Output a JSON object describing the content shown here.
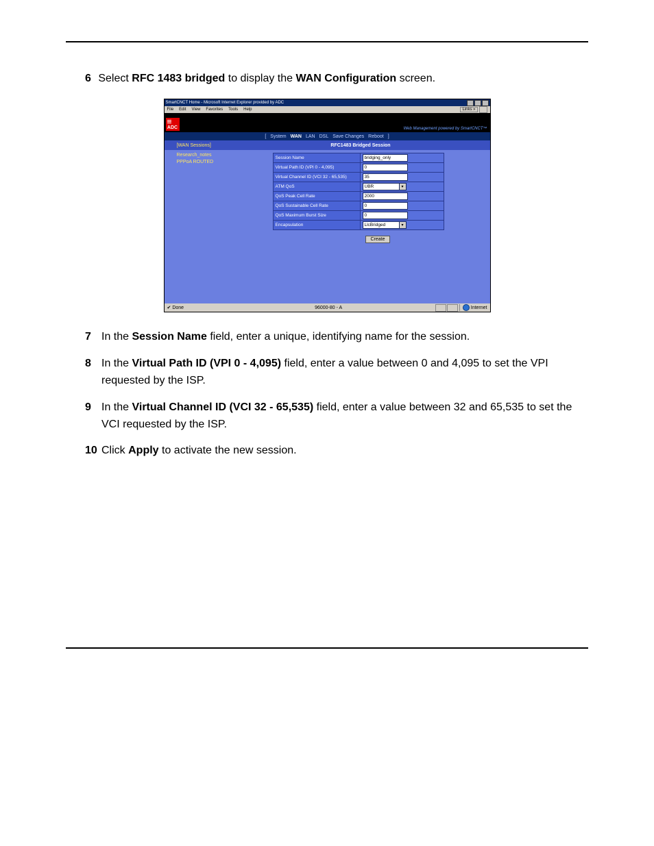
{
  "instruction": {
    "number": "6",
    "prefix": "Select ",
    "link": "RFC 1483 bridged",
    "middle": " to display the ",
    "screen_name": "WAN Configuration",
    "suffix": " screen."
  },
  "screenshot": {
    "window_title": "SmartCNCT Home - Microsoft Internet Explorer provided by ADC",
    "menus": [
      "File",
      "Edit",
      "View",
      "Favorites",
      "Tools",
      "Help"
    ],
    "links_label": "Links »",
    "logo": "ADC",
    "tagline": "Web Management powered by SmartCNCT™",
    "nav": {
      "left_bracket": "[",
      "items": [
        "System",
        "WAN",
        "LAN",
        "DSL",
        "Save Changes",
        "Reboot"
      ],
      "active": "WAN",
      "right_bracket": "]"
    },
    "bar2": {
      "sessions": "[WAN Sessions]",
      "title": "RFC1483 Bridged Session"
    },
    "sidebar": [
      "Research_notes",
      "PPPoA ROUTED"
    ],
    "rows": [
      {
        "label": "Session Name",
        "value": "bridging_only",
        "type": "input"
      },
      {
        "label": "Virtual Path ID (VPI 0 - 4,095)",
        "value": "0",
        "type": "input"
      },
      {
        "label": "Virtual Channel ID (VCI 32 - 65,535)",
        "value": "35",
        "type": "input"
      },
      {
        "label": "ATM QoS",
        "value": "UBR",
        "type": "select"
      },
      {
        "label": "QoS Peak Cell Rate",
        "value": "2000",
        "type": "input"
      },
      {
        "label": "QoS Sustainable Cell Rate",
        "value": "0",
        "type": "input"
      },
      {
        "label": "QoS Maximum Burst Size",
        "value": "0",
        "type": "input"
      },
      {
        "label": "Encapsulation",
        "value": "LlcBridged",
        "type": "select"
      }
    ],
    "create_button": "Create",
    "status": {
      "done": "Done",
      "mid": "96000-80 - A",
      "internet": "Internet"
    }
  },
  "steps": [
    {
      "n": "7",
      "segments": [
        {
          "t": "In the "
        },
        {
          "t": "Session Name",
          "b": true
        },
        {
          "t": " field, enter a unique, identifying name for the session."
        }
      ]
    },
    {
      "n": "8",
      "segments": [
        {
          "t": "In the "
        },
        {
          "t": "Virtual Path ID (VPI 0 - 4,095)",
          "b": true
        },
        {
          "t": " field, enter a value between 0 and 4,095 to set the VPI requested by the ISP."
        }
      ]
    },
    {
      "n": "9",
      "segments": [
        {
          "t": "In the "
        },
        {
          "t": "Virtual Channel ID (VCI 32 - 65,535)",
          "b": true
        },
        {
          "t": " field, enter a value between 32 and 65,535 to set the VCI requested by the ISP."
        }
      ]
    },
    {
      "n": "10",
      "segments": [
        {
          "t": "Click "
        },
        {
          "t": "Apply",
          "b": true
        },
        {
          "t": " to activate the new session."
        }
      ]
    }
  ]
}
